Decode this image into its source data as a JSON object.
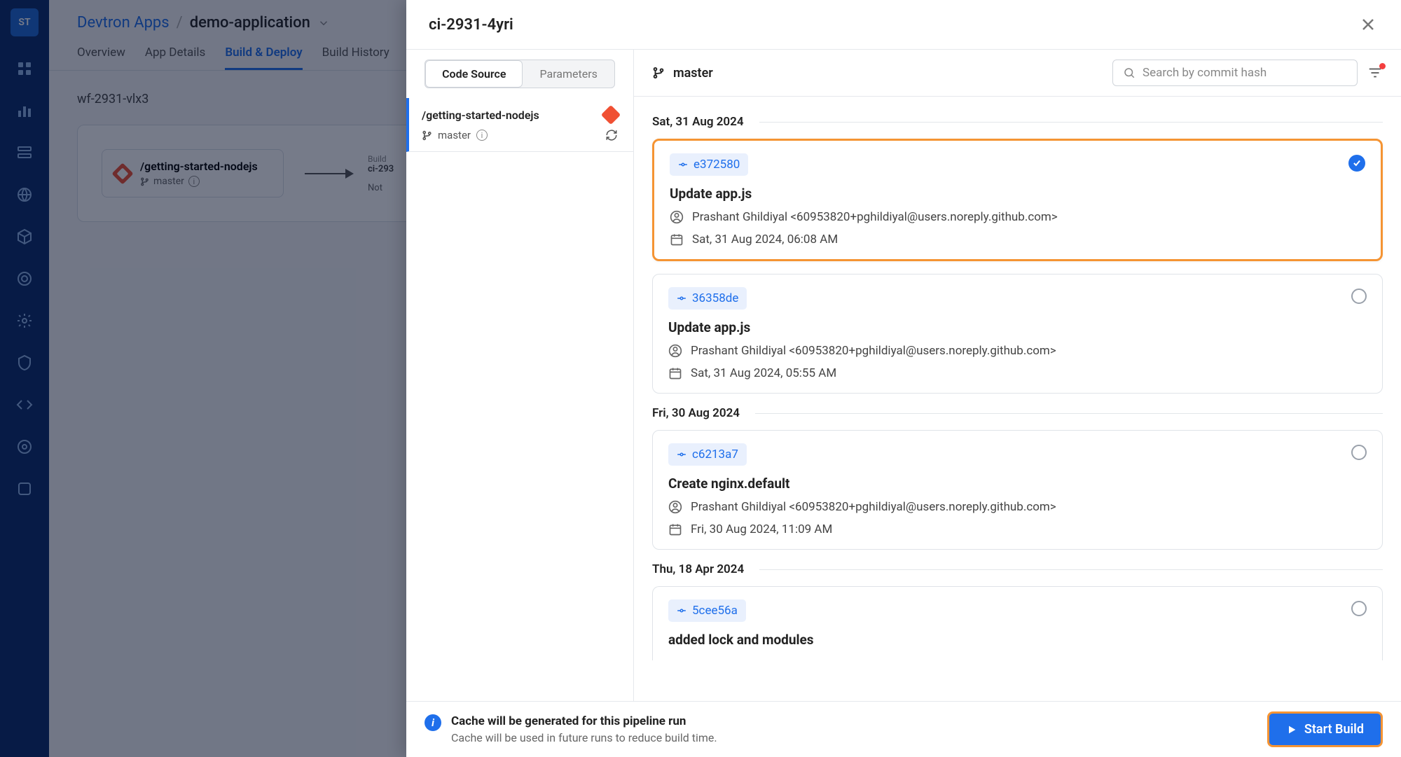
{
  "bg": {
    "breadcrumb_root": "Devtron Apps",
    "breadcrumb_current": "demo-application",
    "tabs": {
      "overview": "Overview",
      "appdetails": "App Details",
      "build": "Build & Deploy",
      "history": "Build History"
    },
    "wf_name": "wf-2931-vlx3",
    "src_repo": "/getting-started-nodejs",
    "src_branch": "master",
    "ci_small": "Build",
    "ci_id": "ci-293",
    "ci_not": "Not "
  },
  "drawer": {
    "title": "ci-2931-4yri",
    "tabs": {
      "code": "Code Source",
      "params": "Parameters"
    },
    "repo": {
      "name": "/getting-started-nodejs",
      "branch": "master"
    },
    "branch_header": "master",
    "search_placeholder": "Search by commit hash",
    "groups": [
      {
        "date": "Sat, 31 Aug 2024",
        "commits": [
          {
            "hash": "e372580",
            "title": "Update app.js",
            "author": "Prashant Ghildiyal <60953820+pghildiyal@users.noreply.github.com>",
            "time": "Sat, 31 Aug 2024, 06:08 AM",
            "selected": true
          },
          {
            "hash": "36358de",
            "title": "Update app.js",
            "author": "Prashant Ghildiyal <60953820+pghildiyal@users.noreply.github.com>",
            "time": "Sat, 31 Aug 2024, 05:55 AM",
            "selected": false
          }
        ]
      },
      {
        "date": "Fri, 30 Aug 2024",
        "commits": [
          {
            "hash": "c6213a7",
            "title": "Create nginx.default",
            "author": "Prashant Ghildiyal <60953820+pghildiyal@users.noreply.github.com>",
            "time": "Fri, 30 Aug 2024, 11:09 AM",
            "selected": false
          }
        ]
      },
      {
        "date": "Thu, 18 Apr 2024",
        "commits": [
          {
            "hash": "5cee56a",
            "title": "added lock and modules",
            "author": "",
            "time": "",
            "selected": false
          }
        ]
      }
    ],
    "footer": {
      "title": "Cache will be generated for this pipeline run",
      "sub": "Cache will be used in future runs to reduce build time.",
      "button": "Start Build"
    }
  }
}
